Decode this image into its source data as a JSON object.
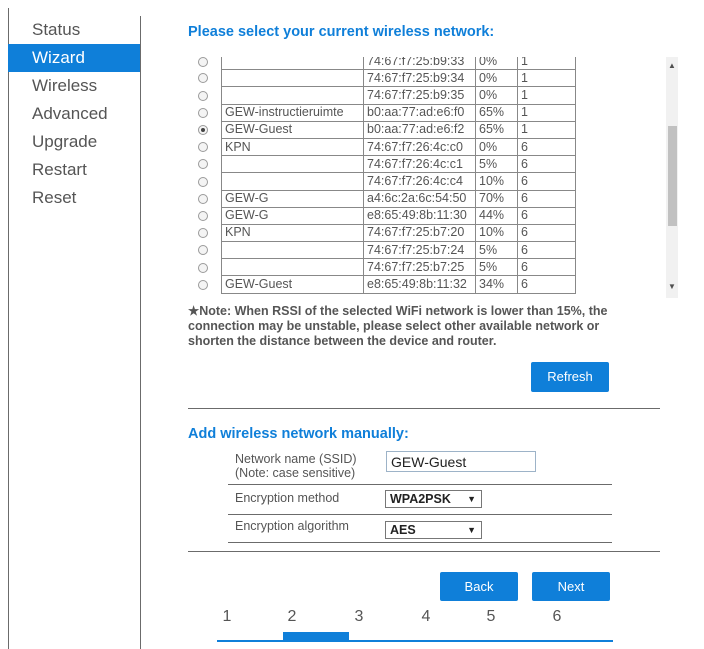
{
  "sidebar": {
    "items": [
      {
        "label": "Status",
        "active": false
      },
      {
        "label": "Wizard",
        "active": true
      },
      {
        "label": "Wireless",
        "active": false
      },
      {
        "label": "Advanced",
        "active": false
      },
      {
        "label": "Upgrade",
        "active": false
      },
      {
        "label": "Restart",
        "active": false
      },
      {
        "label": "Reset",
        "active": false
      }
    ]
  },
  "section_title": "Please select your current wireless network:",
  "networks": [
    {
      "ssid": "",
      "mac": "74:67:f7:25:b9:33",
      "signal": "0%",
      "channel": "1",
      "selected": false
    },
    {
      "ssid": "",
      "mac": "74:67:f7:25:b9:34",
      "signal": "0%",
      "channel": "1",
      "selected": false
    },
    {
      "ssid": "",
      "mac": "74:67:f7:25:b9:35",
      "signal": "0%",
      "channel": "1",
      "selected": false
    },
    {
      "ssid": "GEW-instructieruimte",
      "mac": "b0:aa:77:ad:e6:f0",
      "signal": "65%",
      "channel": "1",
      "selected": false
    },
    {
      "ssid": "GEW-Guest",
      "mac": "b0:aa:77:ad:e6:f2",
      "signal": "65%",
      "channel": "1",
      "selected": true
    },
    {
      "ssid": "KPN",
      "mac": "74:67:f7:26:4c:c0",
      "signal": "0%",
      "channel": "6",
      "selected": false
    },
    {
      "ssid": "",
      "mac": "74:67:f7:26:4c:c1",
      "signal": "5%",
      "channel": "6",
      "selected": false
    },
    {
      "ssid": "",
      "mac": "74:67:f7:26:4c:c4",
      "signal": "10%",
      "channel": "6",
      "selected": false
    },
    {
      "ssid": "GEW-G",
      "mac": "a4:6c:2a:6c:54:50",
      "signal": "70%",
      "channel": "6",
      "selected": false
    },
    {
      "ssid": "GEW-G",
      "mac": "e8:65:49:8b:11:30",
      "signal": "44%",
      "channel": "6",
      "selected": false
    },
    {
      "ssid": "KPN",
      "mac": "74:67:f7:25:b7:20",
      "signal": "10%",
      "channel": "6",
      "selected": false
    },
    {
      "ssid": "",
      "mac": "74:67:f7:25:b7:24",
      "signal": "5%",
      "channel": "6",
      "selected": false
    },
    {
      "ssid": "",
      "mac": "74:67:f7:25:b7:25",
      "signal": "5%",
      "channel": "6",
      "selected": false
    },
    {
      "ssid": "GEW-Guest",
      "mac": "e8:65:49:8b:11:32",
      "signal": "34%",
      "channel": "6",
      "selected": false
    }
  ],
  "note": "★Note: When RSSI of the selected WiFi network is lower than 15%, the connection may be unstable, please select other available network or shorten the distance between the device and router.",
  "refresh_label": "Refresh",
  "manual_title": "Add wireless network manually:",
  "form": {
    "ssid_label": "Network name (SSID)",
    "ssid_note": "(Note: case sensitive)",
    "ssid_value": "GEW-Guest",
    "encryption_label": "Encryption method",
    "encryption_value": "WPA2PSK",
    "algorithm_label": "Encryption algorithm",
    "algorithm_value": "AES"
  },
  "back_label": "Back",
  "next_label": "Next",
  "steps": [
    "1",
    "2",
    "3",
    "4",
    "5",
    "6"
  ],
  "current_step": 2,
  "icons": {
    "scroll_up": "triangle-up",
    "scroll_down": "triangle-down",
    "dropdown": "triangle-down"
  },
  "colors": {
    "accent": "#0f7fd9",
    "text": "#555555"
  }
}
